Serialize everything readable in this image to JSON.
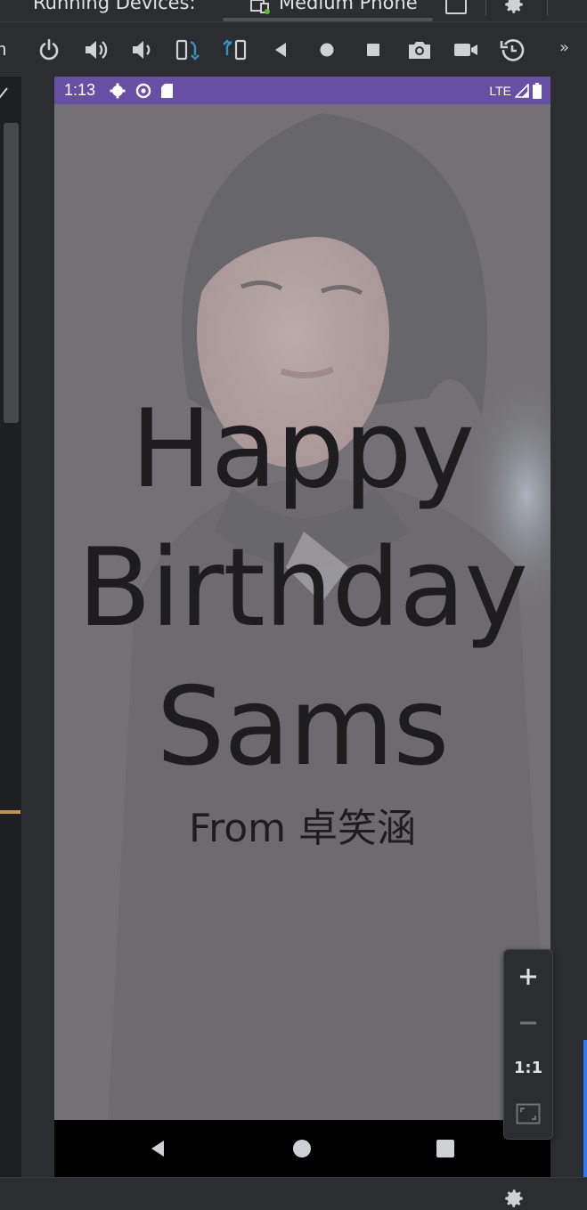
{
  "tabs": {
    "running_devices": "Running Devices:",
    "device": "Medium Phone"
  },
  "toolbar": {
    "left_fragment": "n",
    "more": "»",
    "icons": [
      "power-icon",
      "volume-up-icon",
      "volume-down-icon",
      "rotate-left-icon",
      "rotate-right-icon",
      "back-icon",
      "home-icon",
      "overview-icon",
      "camera-icon",
      "video-icon",
      "reset-icon"
    ]
  },
  "statusbar": {
    "time": "1:13",
    "network": "LTE",
    "color": "#6750a4"
  },
  "app": {
    "greeting": "Happy Birthday Sams",
    "signature": "From 卓笑涵"
  },
  "zoom": {
    "one_to_one": "1:1"
  },
  "colors": {
    "ide_background": "#2b2d30",
    "accent_blue": "#3574f0",
    "accent_gold": "#c09553",
    "text_dark": "#1d1c1f"
  }
}
